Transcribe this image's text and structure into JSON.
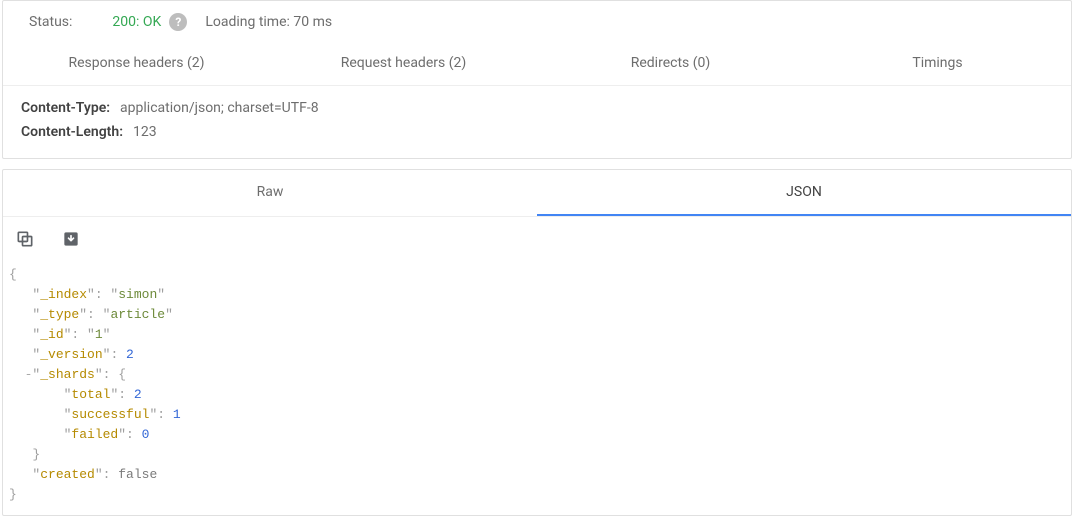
{
  "status": {
    "label": "Status:",
    "code": "200: OK",
    "loading_label": "Loading time: 70 ms"
  },
  "tabs_headers": {
    "response": "Response headers (2)",
    "request": "Request headers (2)",
    "redirects": "Redirects (0)",
    "timings": "Timings"
  },
  "headers": {
    "content_type_key": "Content-Type:",
    "content_type_val": "application/json; charset=UTF-8",
    "content_length_key": "Content-Length:",
    "content_length_val": "123"
  },
  "tabs_body": {
    "raw": "Raw",
    "json": "JSON"
  },
  "json_view": {
    "brace_open": "{",
    "brace_close": "}",
    "k_index": "_index",
    "v_index": "simon",
    "k_type": "_type",
    "v_type": "article",
    "k_id": "_id",
    "v_id": "1",
    "k_version": "_version",
    "v_version": "2",
    "k_shards": "_shards",
    "k_total": "total",
    "v_total": "2",
    "k_successful": "successful",
    "v_successful": "1",
    "k_failed": "failed",
    "v_failed": "0",
    "k_created": "created",
    "v_created": "false",
    "collapse_toggle": "-"
  }
}
